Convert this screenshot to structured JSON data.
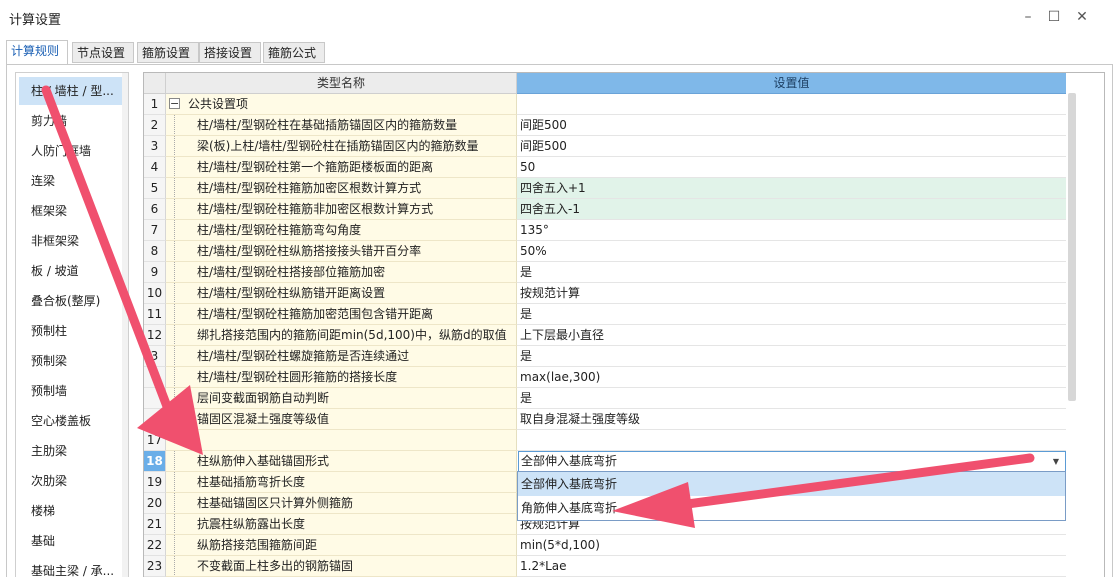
{
  "window": {
    "title": "计算设置"
  },
  "tabs": [
    {
      "label": "计算规则",
      "active": true
    },
    {
      "label": "节点设置"
    },
    {
      "label": "箍筋设置"
    },
    {
      "label": "搭接设置"
    },
    {
      "label": "箍筋公式"
    }
  ],
  "left_nav": [
    "柱 / 墙柱 / 型...",
    "剪力墙",
    "人防门框墙",
    "连梁",
    "框架梁",
    "非框架梁",
    "板 / 坡道",
    "叠合板(整厚)",
    "预制柱",
    "预制梁",
    "预制墙",
    "空心楼盖板",
    "主肋梁",
    "次肋梁",
    "楼梯",
    "基础",
    "基础主梁 / 承..."
  ],
  "grid": {
    "col_name": "类型名称",
    "col_value": "设置值",
    "rows": [
      {
        "num": "1",
        "name": "公共设置项",
        "value": ""
      },
      {
        "num": "2",
        "name": "柱/墙柱/型钢砼柱在基础插筋锚固区内的箍筋数量",
        "value": "间距500"
      },
      {
        "num": "3",
        "name": "梁(板)上柱/墙柱/型钢砼柱在插筋锚固区内的箍筋数量",
        "value": "间距500"
      },
      {
        "num": "4",
        "name": "柱/墙柱/型钢砼柱第一个箍筋距楼板面的距离",
        "value": "50"
      },
      {
        "num": "5",
        "name": "柱/墙柱/型钢砼柱箍筋加密区根数计算方式",
        "value": "四舍五入+1"
      },
      {
        "num": "6",
        "name": "柱/墙柱/型钢砼柱箍筋非加密区根数计算方式",
        "value": "四舍五入-1"
      },
      {
        "num": "7",
        "name": "柱/墙柱/型钢砼柱箍筋弯勾角度",
        "value": "135°"
      },
      {
        "num": "8",
        "name": "柱/墙柱/型钢砼柱纵筋搭接接头错开百分率",
        "value": "50%"
      },
      {
        "num": "9",
        "name": "柱/墙柱/型钢砼柱搭接部位箍筋加密",
        "value": "是"
      },
      {
        "num": "10",
        "name": "柱/墙柱/型钢砼柱纵筋错开距离设置",
        "value": "按规范计算"
      },
      {
        "num": "11",
        "name": "柱/墙柱/型钢砼柱箍筋加密范围包含错开距离",
        "value": "是"
      },
      {
        "num": "12",
        "name": "绑扎搭接范围内的箍筋间距min(5d,100)中，纵筋d的取值",
        "value": "上下层最小直径"
      },
      {
        "num": "3",
        "name": "柱/墙柱/型钢砼柱螺旋箍筋是否连续通过",
        "value": "是"
      },
      {
        "num": "",
        "name": "柱/墙柱/型钢砼柱圆形箍筋的搭接长度",
        "value": "max(lae,300)"
      },
      {
        "num": "",
        "name": "层间变截面钢筋自动判断",
        "value": "是"
      },
      {
        "num": "",
        "name": "锚固区混凝土强度等级值",
        "value": "取自身混凝土强度等级"
      },
      {
        "num": "17",
        "name": "柱",
        "value": ""
      },
      {
        "num": "18",
        "name": "柱纵筋伸入基础锚固形式",
        "value": "全部伸入基底弯折"
      },
      {
        "num": "19",
        "name": "柱基础插筋弯折长度",
        "value": ""
      },
      {
        "num": "20",
        "name": "柱基础锚固区只计算外侧箍筋",
        "value": ""
      },
      {
        "num": "21",
        "name": "抗震柱纵筋露出长度",
        "value": "按规范计算"
      },
      {
        "num": "22",
        "name": "纵筋搭接范围箍筋间距",
        "value": "min(5*d,100)"
      },
      {
        "num": "23",
        "name": "不变截面上柱多出的钢筋锚固",
        "value": "1.2*Lae"
      }
    ]
  },
  "dropdown": {
    "options": [
      "全部伸入基底弯折",
      "角筋伸入基底弯折"
    ],
    "highlighted": 0
  },
  "colors": {
    "header_value_bg": "#7fb8e9",
    "selected_row_num": "#6aaee8",
    "name_col_bg": "#fffbe6",
    "green_row_bg": "#e1f3e9",
    "annotation_arrow": "#f0506e"
  },
  "icons": {
    "minimize": "minimize-icon",
    "maximize": "maximize-icon",
    "close": "close-icon",
    "collapse": "collapse-icon",
    "dropdown": "chevron-down-icon"
  }
}
